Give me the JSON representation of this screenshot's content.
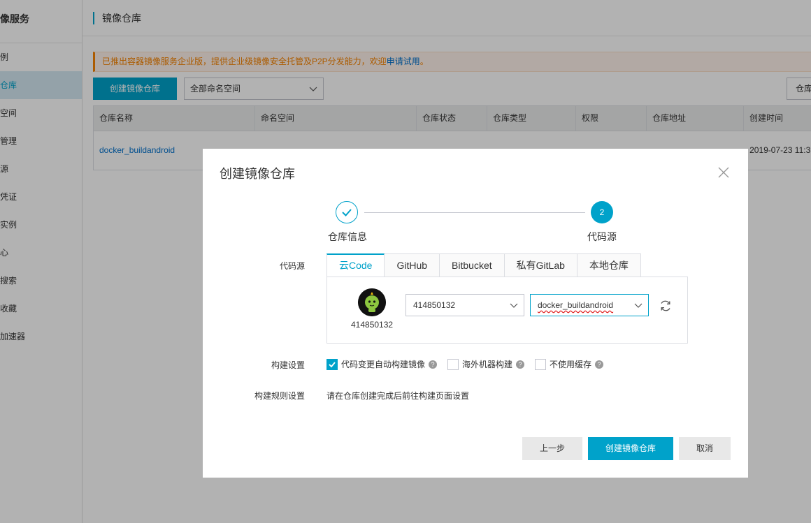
{
  "sidebar": {
    "title": "镜像服务",
    "items": [
      {
        "label": "例"
      },
      {
        "label": "仓库"
      },
      {
        "label": "空间"
      },
      {
        "label": "管理"
      },
      {
        "label": "源"
      },
      {
        "label": "凭证"
      },
      {
        "label": "实例"
      },
      {
        "label": "心"
      },
      {
        "label": "搜索"
      },
      {
        "label": "收藏"
      },
      {
        "label": "加速器"
      }
    ]
  },
  "header": {
    "title": "镜像仓库"
  },
  "notice": {
    "text": "已推出容器镜像服务企业版，提供企业级镜像安全托管及P2P分发能力，欢迎",
    "link": "申请试用",
    "end": "。"
  },
  "toolbar": {
    "create_label": "创建镜像仓库",
    "namespace_select": "全部命名空间",
    "right_button": "仓库"
  },
  "table": {
    "headers": [
      "仓库名称",
      "命名空间",
      "仓库状态",
      "仓库类型",
      "权限",
      "仓库地址",
      "创建时间"
    ],
    "rows": [
      {
        "name": "docker_buildandroid",
        "created": "2019-07-23 11:3"
      }
    ]
  },
  "modal": {
    "title": "创建镜像仓库",
    "steps": [
      {
        "label": "仓库信息",
        "state": "done"
      },
      {
        "label": "代码源",
        "number": "2",
        "state": "active"
      }
    ],
    "source_label": "代码源",
    "tabs": [
      {
        "label": "云Code",
        "active": true
      },
      {
        "label": "GitHub"
      },
      {
        "label": "Bitbucket"
      },
      {
        "label": "私有GitLab"
      },
      {
        "label": "本地仓库"
      }
    ],
    "account": {
      "name": "414850132",
      "select_value": "414850132",
      "repo_value": "docker_buildandroid"
    },
    "build_settings_label": "构建设置",
    "options": [
      {
        "label": "代码变更自动构建镜像",
        "checked": true
      },
      {
        "label": "海外机器构建",
        "checked": false
      },
      {
        "label": "不使用缓存",
        "checked": false
      }
    ],
    "build_rules_label": "构建规则设置",
    "build_rules_text": "请在仓库创建完成后前往构建页面设置",
    "buttons": {
      "prev": "上一步",
      "create": "创建镜像仓库",
      "cancel": "取消"
    },
    "help_glyph": "?"
  },
  "colors": {
    "primary": "#00a2ca",
    "notice": "#f68300",
    "link": "#0070cc"
  }
}
